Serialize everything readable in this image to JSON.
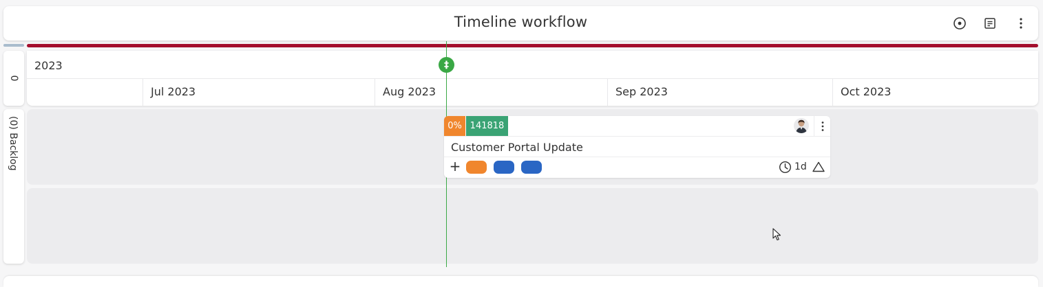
{
  "header": {
    "title": "Timeline workflow",
    "icons": [
      "target-icon",
      "report-icon",
      "more-vertical-icon"
    ]
  },
  "swimlane_header": {
    "label": "0"
  },
  "timescale": {
    "year": "2023",
    "months": [
      "Jul 2023",
      "Aug 2023",
      "Sep 2023",
      "Oct 2023"
    ]
  },
  "today_marker": {
    "symbol": "‡",
    "color": "#3aa845"
  },
  "lanes": [
    {
      "label": "(0) Backlog"
    }
  ],
  "card": {
    "progress": "0%",
    "id": "141818",
    "title": "Customer Portal Update",
    "add_symbol": "+",
    "duration": "1d",
    "tags": [
      {
        "color": "#f0862d"
      },
      {
        "color": "#2a66c4"
      },
      {
        "color": "#2a66c4"
      }
    ],
    "colors": {
      "progress": "#f0862d",
      "id": "#3aa374"
    }
  },
  "colors": {
    "accent_red": "#a30f2d",
    "today_green": "#3aa845",
    "lane_bg": "#ececee"
  }
}
